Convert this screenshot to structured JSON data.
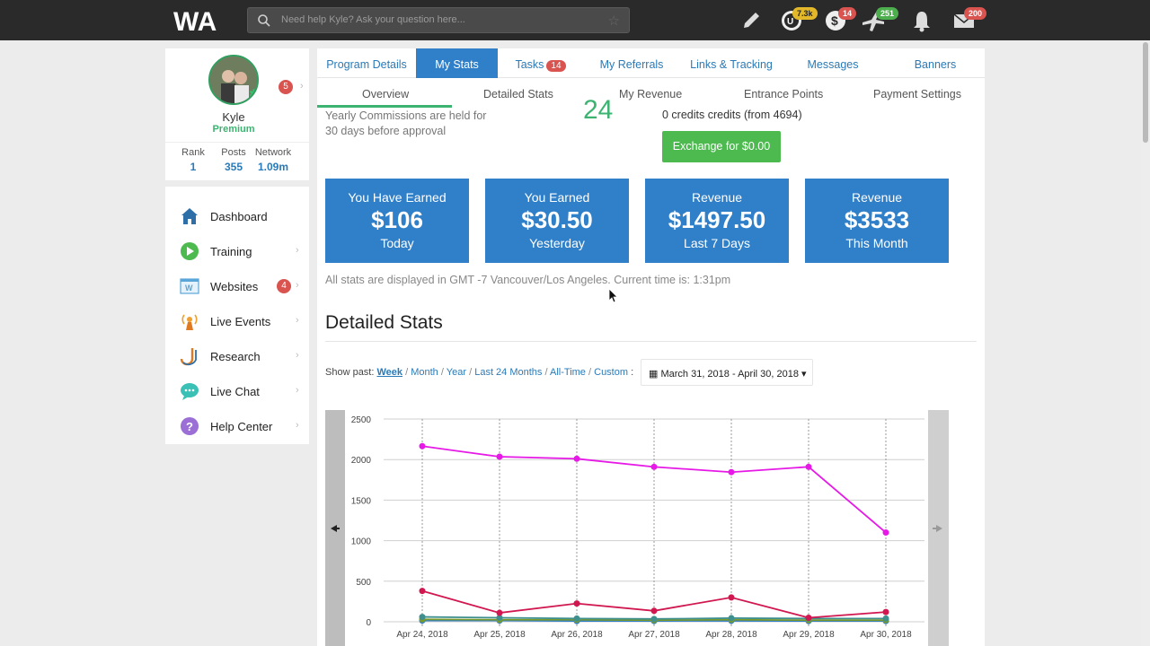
{
  "topbar": {
    "logo_text": "WA",
    "search_placeholder": "Need help Kyle? Ask your question here...",
    "badges": {
      "credits": "7.3k",
      "money": "14",
      "airplane": "251",
      "mail": "200"
    }
  },
  "profile": {
    "name": "Kyle",
    "tier": "Premium",
    "notification_count": "5",
    "stats": [
      {
        "label": "Rank",
        "value": "1"
      },
      {
        "label": "Posts",
        "value": "355"
      },
      {
        "label": "Network",
        "value": "1.09m"
      }
    ]
  },
  "nav": {
    "items": [
      {
        "label": "Dashboard"
      },
      {
        "label": "Training"
      },
      {
        "label": "Websites",
        "badge": "4"
      },
      {
        "label": "Live Events"
      },
      {
        "label": "Research"
      },
      {
        "label": "Live Chat"
      },
      {
        "label": "Help Center"
      }
    ]
  },
  "tabs": {
    "items": [
      {
        "label": "Program Details"
      },
      {
        "label": "My Stats"
      },
      {
        "label": "Tasks",
        "badge": "14"
      },
      {
        "label": "My Referrals"
      },
      {
        "label": "Links & Tracking"
      },
      {
        "label": "Messages"
      },
      {
        "label": "Banners"
      }
    ],
    "active": "My Stats"
  },
  "subtabs": {
    "items": [
      "Overview",
      "Detailed Stats",
      "My Revenue",
      "Entrance Points",
      "Payment Settings"
    ],
    "active": "Overview"
  },
  "overview": {
    "note": "Yearly Commissions are held for 30 days before approval",
    "big_number": "24",
    "credits_text": "0 credits credits (from 4694)",
    "exchange_label": "Exchange for $0.00"
  },
  "cards": [
    {
      "title": "You Have Earned",
      "amount": "$106",
      "period": "Today"
    },
    {
      "title": "You Earned",
      "amount": "$30.50",
      "period": "Yesterday"
    },
    {
      "title": "Revenue",
      "amount": "$1497.50",
      "period": "Last 7 Days"
    },
    {
      "title": "Revenue",
      "amount": "$3533",
      "period": "This Month"
    }
  ],
  "timezone_note": "All stats are displayed in GMT -7 Vancouver/Los Angeles. Current time is: 1:31pm",
  "detailed_stats": {
    "heading": "Detailed Stats",
    "show_past_label": "Show past:",
    "filters": [
      "Week",
      "Month",
      "Year",
      "Last 24 Months",
      "All-Time",
      "Custom"
    ],
    "active_filter": "Week",
    "date_range": "March 31, 2018 - April 30, 2018"
  },
  "chart_data": {
    "type": "line",
    "categories": [
      "Apr 24, 2018",
      "Apr 25, 2018",
      "Apr 26, 2018",
      "Apr 27, 2018",
      "Apr 28, 2018",
      "Apr 29, 2018",
      "Apr 30, 2018"
    ],
    "ylim": [
      0,
      2500
    ],
    "yticks": [
      0,
      500,
      1000,
      1500,
      2000,
      2500
    ],
    "grid": true,
    "series": [
      {
        "color": "#e619e6",
        "values": [
          2165,
          2035,
          2010,
          1910,
          1845,
          1910,
          1100
        ]
      },
      {
        "color": "#d1174f",
        "values": [
          380,
          110,
          225,
          135,
          300,
          50,
          120
        ]
      },
      {
        "color": "#3f8f8f",
        "values": [
          60,
          50,
          40,
          35,
          45,
          40,
          40
        ]
      },
      {
        "color": "#7a9a2a",
        "values": [
          30,
          25,
          25,
          20,
          25,
          20,
          20
        ]
      },
      {
        "color": "#2f7fc9",
        "values": [
          15,
          15,
          10,
          10,
          12,
          10,
          10
        ]
      }
    ]
  },
  "colors": {
    "primary": "#2f7fc9",
    "success": "#4cba4f",
    "danger": "#d9534f",
    "topbar": "#2a2a2a"
  }
}
